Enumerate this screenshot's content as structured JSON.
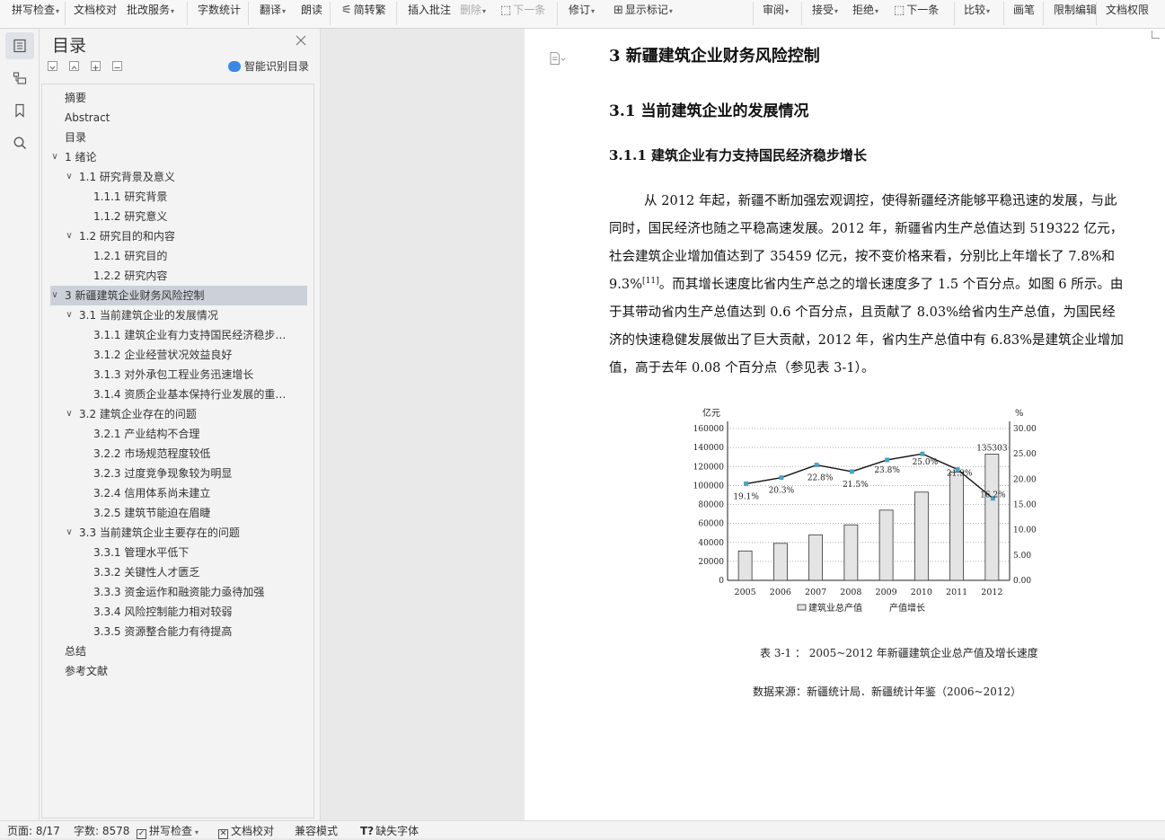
{
  "toolbar": {
    "items": [
      {
        "label": "拼写检查",
        "caret": true
      },
      {
        "label": "文档校对",
        "caret": false
      },
      {
        "label": "批改服务",
        "caret": true
      },
      {
        "label": "字数统计",
        "caret": false
      },
      {
        "label": "翻译",
        "caret": true
      },
      {
        "label": "朗读",
        "caret": false
      },
      {
        "label": "简转繁",
        "caret": false
      },
      {
        "label": "插入批注",
        "caret": false
      },
      {
        "label": "删除",
        "caret": true
      },
      {
        "label": "下一条",
        "caret": false
      },
      {
        "label": "修订",
        "caret": true
      },
      {
        "label": "显示标记",
        "caret": true
      },
      {
        "label": "审阅",
        "caret": true
      },
      {
        "label": "接受",
        "caret": true
      },
      {
        "label": "拒绝",
        "caret": true
      },
      {
        "label": "下一条",
        "caret": false
      },
      {
        "label": "比较",
        "caret": true
      },
      {
        "label": "画笔",
        "caret": false
      },
      {
        "label": "限制编辑",
        "caret": false
      },
      {
        "label": "文档权限",
        "caret": false
      }
    ]
  },
  "rail": {
    "icons": [
      "toc-icon",
      "outline-icon",
      "bookmark-icon",
      "search-icon"
    ]
  },
  "toc": {
    "title": "目录",
    "smart_label": "智能识别目录",
    "items": [
      {
        "label": "摘要",
        "level": 0,
        "chev": ""
      },
      {
        "label": "Abstract",
        "level": 0,
        "chev": ""
      },
      {
        "label": "目录",
        "level": 0,
        "chev": ""
      },
      {
        "label": "1  绪论",
        "level": 0,
        "chev": "∨"
      },
      {
        "label": "1.1  研究背景及意义",
        "level": 1,
        "chev": "∨"
      },
      {
        "label": "1.1.1 研究背景",
        "level": 2,
        "chev": ""
      },
      {
        "label": "1.1.2 研究意义",
        "level": 2,
        "chev": ""
      },
      {
        "label": "1.2 研究目的和内容",
        "level": 1,
        "chev": "∨"
      },
      {
        "label": "1.2.1 研究目的",
        "level": 2,
        "chev": ""
      },
      {
        "label": "1.2.2 研究内容",
        "level": 2,
        "chev": ""
      },
      {
        "label": "3  新疆建筑企业财务风险控制",
        "level": 0,
        "chev": "∨",
        "selected": true
      },
      {
        "label": "3.1  当前建筑企业的发展情况",
        "level": 1,
        "chev": "∨"
      },
      {
        "label": "3.1.1 建筑企业有力支持国民经济稳步增长",
        "level": 2,
        "chev": ""
      },
      {
        "label": "3.1.2 企业经营状况效益良好",
        "level": 2,
        "chev": ""
      },
      {
        "label": "3.1.3  对外承包工程业务迅速增长",
        "level": 2,
        "chev": ""
      },
      {
        "label": "3.1.4  资质企业基本保持行业发展的重要地位",
        "level": 2,
        "chev": ""
      },
      {
        "label": "3.2 建筑企业存在的问题",
        "level": 1,
        "chev": "∨"
      },
      {
        "label": "3.2.1 产业结构不合理",
        "level": 2,
        "chev": ""
      },
      {
        "label": "3.2.2 市场规范程度较低",
        "level": 2,
        "chev": ""
      },
      {
        "label": "3.2.3 过度竞争现象较为明显",
        "level": 2,
        "chev": ""
      },
      {
        "label": "3.2.4 信用体系尚未建立",
        "level": 2,
        "chev": ""
      },
      {
        "label": "3.2.5 建筑节能迫在眉睫",
        "level": 2,
        "chev": ""
      },
      {
        "label": "3.3 当前建筑企业主要存在的问题",
        "level": 1,
        "chev": "∨"
      },
      {
        "label": "3.3.1 管理水平低下",
        "level": 2,
        "chev": ""
      },
      {
        "label": "3.3.2 关键性人才匮乏",
        "level": 2,
        "chev": ""
      },
      {
        "label": "3.3.3 资金运作和融资能力亟待加强",
        "level": 2,
        "chev": ""
      },
      {
        "label": "3.3.4 风险控制能力相对较弱",
        "level": 2,
        "chev": ""
      },
      {
        "label": "3.3.5 资源整合能力有待提高",
        "level": 2,
        "chev": ""
      },
      {
        "label": "总结",
        "level": 0,
        "chev": ""
      },
      {
        "label": "参考文献",
        "level": 0,
        "chev": ""
      }
    ]
  },
  "document": {
    "h1": "3  新疆建筑企业财务风险控制",
    "h2": "3.1  当前建筑企业的发展情况",
    "h3": "3.1.1 建筑企业有力支持国民经济稳步增长",
    "lines": [
      "从 2012 年起，新疆不断加强宏观调控，使得新疆经济能够平稳迅速的发展，与此",
      "同时，国民经济也随之平稳高速发展。2012 年，新疆省内生产总值达到 519322 亿元，",
      "社会建筑企业增加值达到了 35459 亿元，按不变价格来看，分别比上年增长了 7.8%和",
      "9.3%",
      "。而其增长速度比省内生产总之的增长速度多了 1.5 个百分点。如图 6 所示。由",
      "于其带动省内生产总值达到 0.6 个百分点，且贡献了 8.03%给省内生产总值，为国民经",
      "济的快速稳健发展做出了巨大贡献，2012 年，省内生产总值中有 6.83%是建筑企业增加",
      "值，高于去年 0.08 个百分点（参见表 3-1）。"
    ],
    "citation": "[11]",
    "caption": "表 3-1 ： 2005~2012  年新疆建筑企业总产值及增长速度",
    "source": "数据来源：新疆统计局．新疆统计年鉴（2006~2012）"
  },
  "chart_data": {
    "type": "bar+line",
    "categories": [
      "2005",
      "2006",
      "2007",
      "2008",
      "2009",
      "2010",
      "2011",
      "2012"
    ],
    "series": [
      {
        "name": "建筑业总产值",
        "type": "bar",
        "axis": "left",
        "values": [
          31000,
          39000,
          48000,
          58500,
          74000,
          93000,
          114000,
          133000
        ]
      },
      {
        "name": "产值增长",
        "type": "line",
        "axis": "right",
        "values": [
          19.1,
          20.3,
          22.8,
          21.5,
          23.8,
          25.0,
          21.9,
          16.2
        ]
      }
    ],
    "bar_top_label": {
      "index": 7,
      "text": "135303"
    },
    "line_labels": [
      "19.1%",
      "20.3%",
      "22.8%",
      "21.5%",
      "23.8%",
      "25.0%",
      "21.9%",
      "16.2%"
    ],
    "left_unit": "亿元",
    "right_unit": "%",
    "left_ticks": [
      "0",
      "20000",
      "40000",
      "60000",
      "80000",
      "100000",
      "120000",
      "140000",
      "160000"
    ],
    "right_ticks": [
      "0.00",
      "5.00",
      "10.00",
      "15.00",
      "20.00",
      "25.00",
      "30.00"
    ],
    "ylim_left": [
      0,
      160000
    ],
    "ylim_right": [
      0,
      30
    ],
    "grid": "dotted-horizontal",
    "legend_position": "bottom",
    "line_color": "#111111",
    "marker_color": "#4aa3c4"
  },
  "statusbar": {
    "page": "页面: 8/17",
    "words": "字数: 8578",
    "spell": "拼写检查",
    "proof": "文档校对",
    "compat": "兼容模式",
    "missing_font": "缺失字体"
  }
}
